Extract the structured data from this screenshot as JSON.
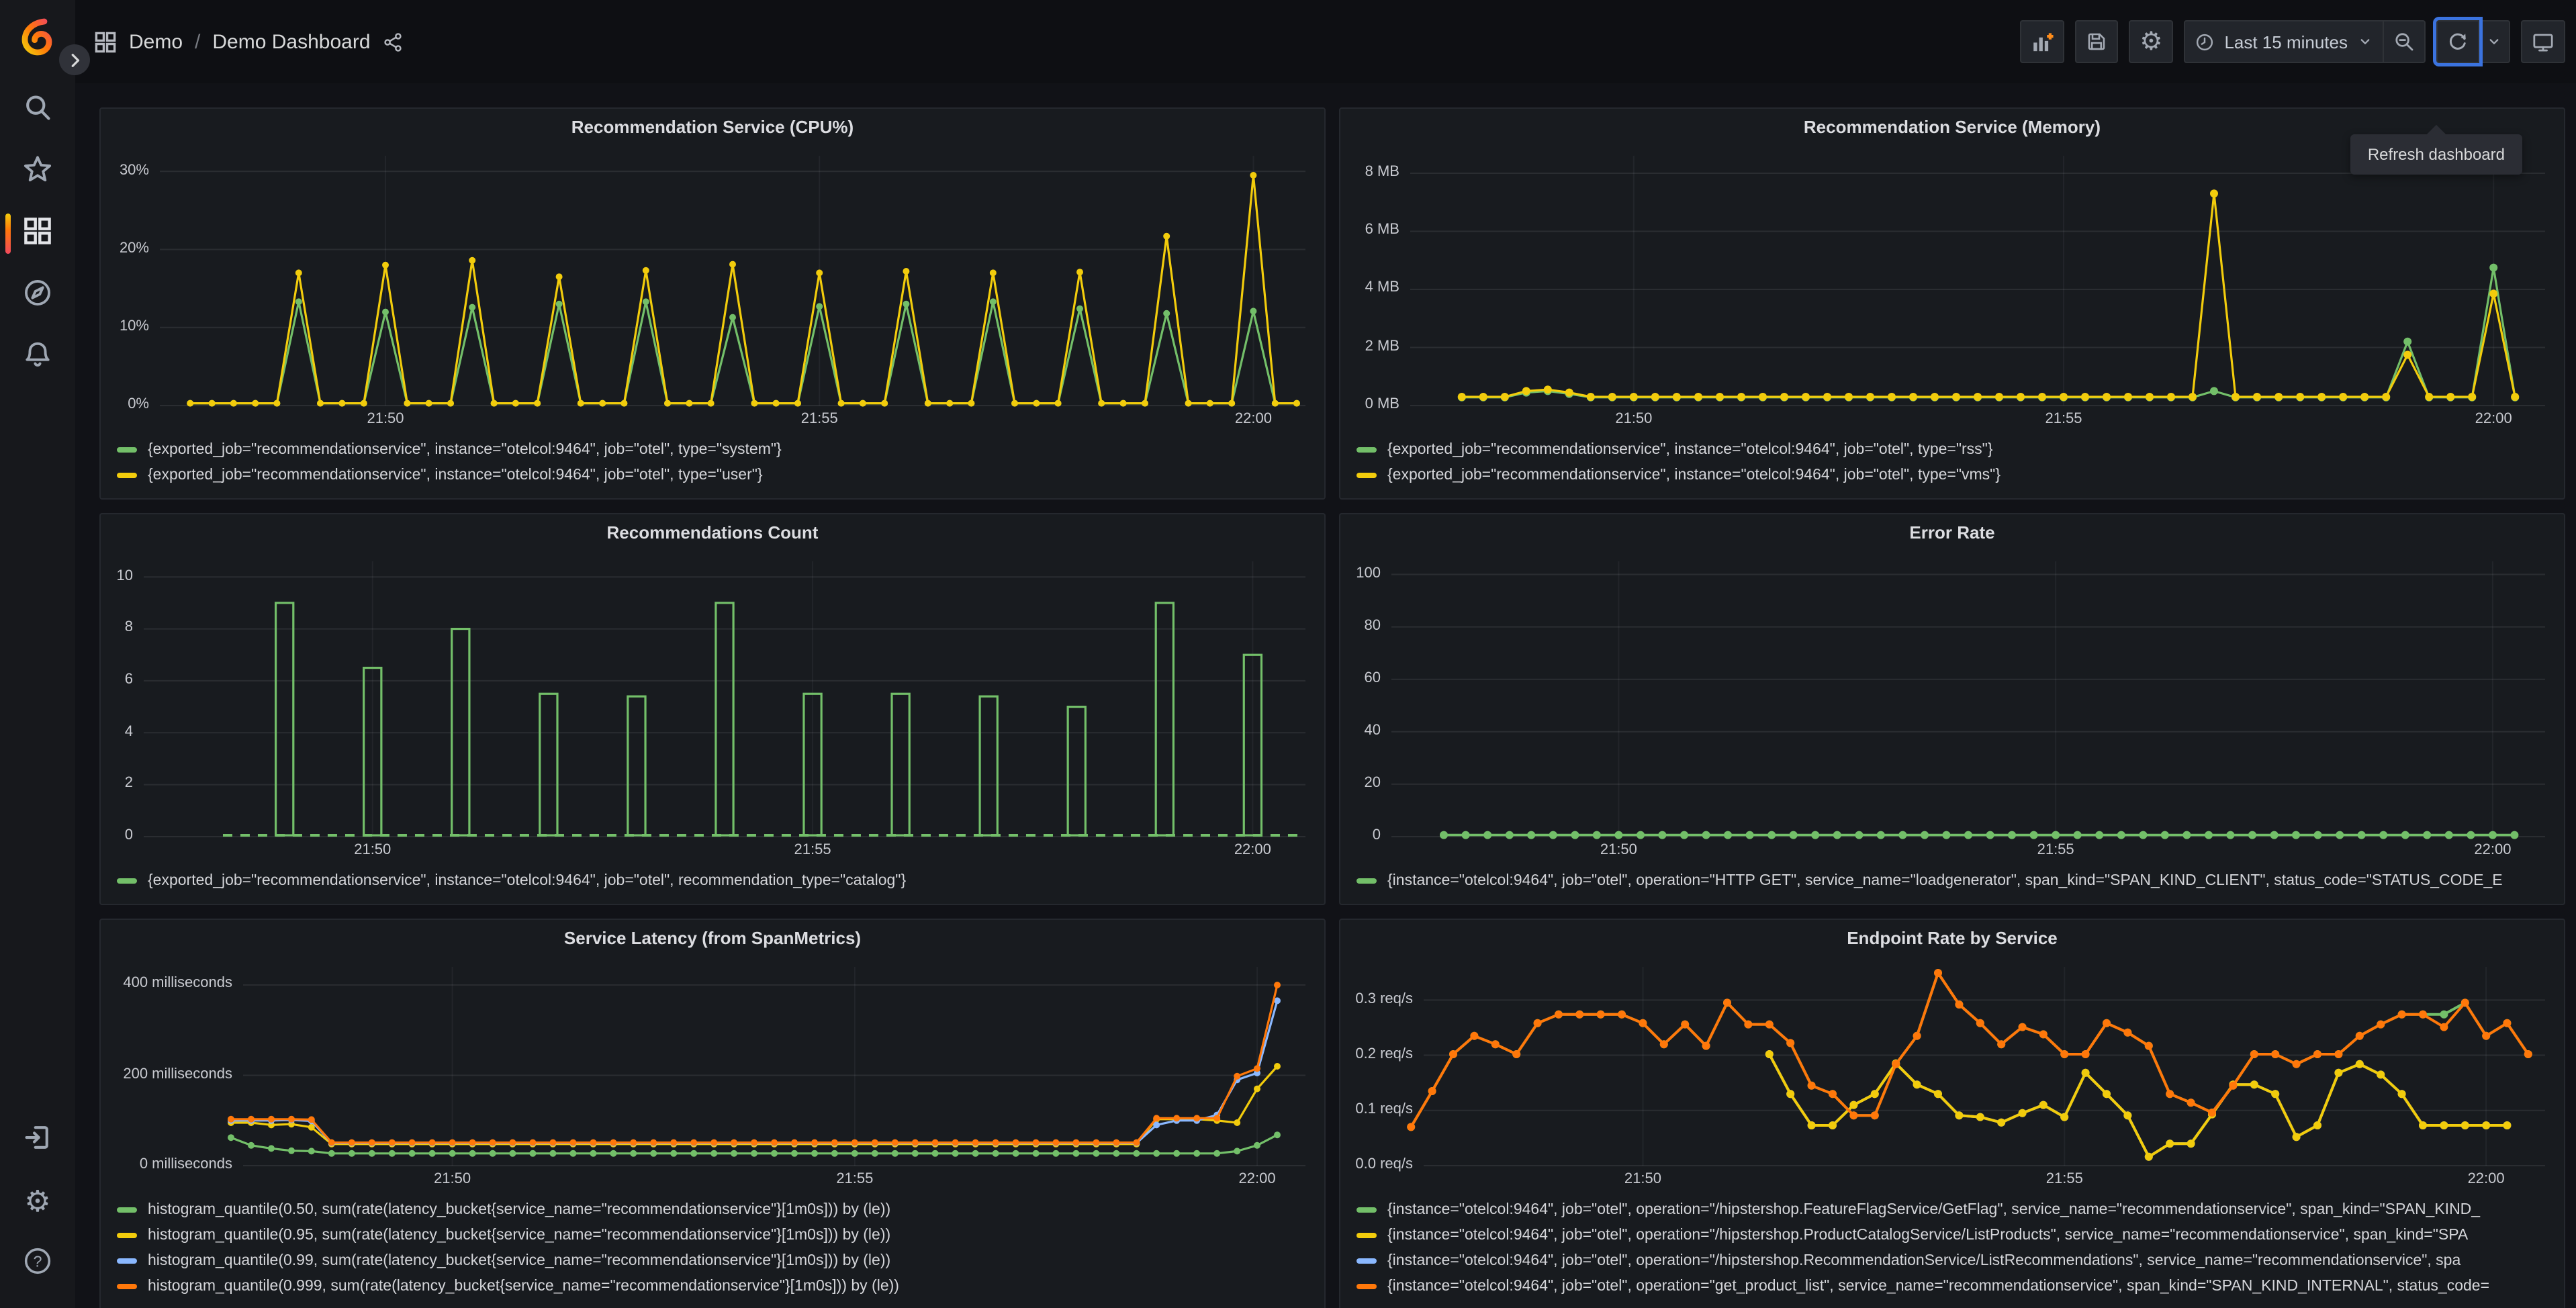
{
  "colors": {
    "green": "#73BF69",
    "yellow": "#F2CC0C",
    "blue": "#8AB8FF",
    "orange": "#FF780A",
    "accent_orange": "#F05A28",
    "focus_blue": "#3B73DF",
    "panel_bg": "#181B1F",
    "page_bg": "#111217"
  },
  "sidebar": {
    "items": [
      {
        "name": "search",
        "icon": "search-icon"
      },
      {
        "name": "starred",
        "icon": "star-icon"
      },
      {
        "name": "dashboards",
        "icon": "apps-icon",
        "active": true
      },
      {
        "name": "explore",
        "icon": "compass-icon"
      },
      {
        "name": "alerting",
        "icon": "bell-icon"
      }
    ],
    "bottom_items": [
      {
        "name": "sign-in",
        "icon": "sign-in-icon"
      },
      {
        "name": "configuration",
        "icon": "gear-icon"
      },
      {
        "name": "help",
        "icon": "help-icon"
      }
    ]
  },
  "topbar": {
    "breadcrumb": {
      "folder": "Demo",
      "separator": "/",
      "dashboard": "Demo Dashboard"
    },
    "time_picker": {
      "label": "Last 15 minutes"
    },
    "tooltip": "Refresh dashboard"
  },
  "panels": [
    {
      "title": "Recommendation Service (CPU%)",
      "legend": [
        {
          "color": "green",
          "label": "{exported_job=\"recommendationservice\", instance=\"otelcol:9464\", job=\"otel\", type=\"system\"}"
        },
        {
          "color": "yellow",
          "label": "{exported_job=\"recommendationservice\", instance=\"otelcol:9464\", job=\"otel\", type=\"user\"}"
        }
      ],
      "chart_data": {
        "type": "line",
        "x_unit": "minutes after 21:45",
        "x_domain": [
          2.4,
          15.6
        ],
        "y_domain": [
          0,
          32
        ],
        "x_ticks": [
          {
            "v": 5,
            "l": "21:50"
          },
          {
            "v": 10,
            "l": "21:55"
          },
          {
            "v": 15,
            "l": "22:00"
          }
        ],
        "y_ticks": [
          {
            "v": 0,
            "l": "0%"
          },
          {
            "v": 10,
            "l": "10%"
          },
          {
            "v": 20,
            "l": "20%"
          },
          {
            "v": 30,
            "l": "30%"
          }
        ],
        "axis_width": 36,
        "series": [
          {
            "name": "system",
            "color": "green",
            "mode": "spikes",
            "start": 2.75,
            "end": 15.5,
            "step": 0.25,
            "baseline": 0.3,
            "r": 2.5,
            "w": 1.6,
            "spikes": {
              "4": 13.3,
              "5": 12,
              "6": 12.6,
              "7": 13,
              "8": 13.3,
              "9": 11.3,
              "10": 12.7,
              "11": 13,
              "12": 13.3,
              "13": 12.4,
              "14": 11.8,
              "15": 12.1
            }
          },
          {
            "name": "user",
            "color": "yellow",
            "mode": "spikes",
            "start": 2.75,
            "end": 15.5,
            "step": 0.25,
            "baseline": 0.3,
            "r": 2.5,
            "w": 1.6,
            "spikes": {
              "4": 17,
              "5": 18,
              "6": 18.6,
              "7": 16.5,
              "8": 17.3,
              "9": 18.1,
              "10": 17,
              "11": 17.2,
              "12": 17,
              "13": 17.1,
              "14": 21.7,
              "15": 29.5
            }
          }
        ]
      }
    },
    {
      "title": "Recommendation Service (Memory)",
      "legend": [
        {
          "color": "green",
          "label": "{exported_job=\"recommendationservice\", instance=\"otelcol:9464\", job=\"otel\", type=\"rss\"}"
        },
        {
          "color": "yellow",
          "label": "{exported_job=\"recommendationservice\", instance=\"otelcol:9464\", job=\"otel\", type=\"vms\"}"
        }
      ],
      "chart_data": {
        "type": "line",
        "x_unit": "minutes after 21:45",
        "x_domain": [
          2.4,
          15.6
        ],
        "y_domain": [
          0,
          8.6
        ],
        "x_ticks": [
          {
            "v": 5,
            "l": "21:50"
          },
          {
            "v": 10,
            "l": "21:55"
          },
          {
            "v": 15,
            "l": "22:00"
          }
        ],
        "y_ticks": [
          {
            "v": 0,
            "l": "0 MB"
          },
          {
            "v": 2,
            "l": "2 MB"
          },
          {
            "v": 4,
            "l": "4 MB"
          },
          {
            "v": 6,
            "l": "6 MB"
          },
          {
            "v": 8,
            "l": "8 MB"
          }
        ],
        "axis_width": 44,
        "series": [
          {
            "name": "rss",
            "color": "green",
            "mode": "spikes",
            "start": 3.0,
            "end": 15.25,
            "step": 0.25,
            "baseline": 0.28,
            "r": 3,
            "w": 1.6,
            "spikes": {
              "3.75": 0.45,
              "4": 0.5,
              "4.25": 0.4,
              "11.75": 0.5,
              "14": 2.2,
              "15": 4.75
            }
          },
          {
            "name": "vms",
            "color": "yellow",
            "mode": "spikes",
            "start": 3.0,
            "end": 15.25,
            "step": 0.25,
            "baseline": 0.3,
            "r": 3,
            "w": 1.6,
            "spikes": {
              "3.75": 0.5,
              "4": 0.55,
              "4.25": 0.45,
              "11.75": 7.3,
              "14": 1.75,
              "15": 3.85
            }
          }
        ]
      }
    },
    {
      "title": "Recommendations Count",
      "legend": [
        {
          "color": "green",
          "label": "{exported_job=\"recommendationservice\", instance=\"otelcol:9464\", job=\"otel\", recommendation_type=\"catalog\"}"
        }
      ],
      "chart_data": {
        "type": "bar",
        "x_unit": "minutes after 21:45",
        "x_domain": [
          2.4,
          15.6
        ],
        "y_domain": [
          0,
          10.6
        ],
        "x_ticks": [
          {
            "v": 5,
            "l": "21:50"
          },
          {
            "v": 10,
            "l": "21:55"
          },
          {
            "v": 15,
            "l": "22:00"
          }
        ],
        "y_ticks": [
          {
            "v": 0,
            "l": "0"
          },
          {
            "v": 2,
            "l": "2"
          },
          {
            "v": 4,
            "l": "4"
          },
          {
            "v": 6,
            "l": "6"
          },
          {
            "v": 8,
            "l": "8"
          },
          {
            "v": 10,
            "l": "10"
          }
        ],
        "axis_width": 24,
        "series": [
          {
            "name": "baseline",
            "color": "green",
            "mode": "dashline",
            "from": 3.3,
            "to": 15.55,
            "y": 0,
            "w": 2
          },
          {
            "name": "catalog",
            "color": "green",
            "mode": "bars",
            "barw": 0.2,
            "w": 1.6,
            "times": [
              4,
              5,
              6,
              7,
              8,
              9,
              10,
              11,
              12,
              13,
              14,
              15
            ],
            "values": [
              9,
              6.5,
              8,
              5.5,
              5.4,
              9,
              5.5,
              5.5,
              5.4,
              5,
              9,
              7
            ]
          }
        ]
      }
    },
    {
      "title": "Error Rate",
      "legend": [
        {
          "color": "green",
          "label": "{instance=\"otelcol:9464\", job=\"otel\", operation=\"HTTP GET\", service_name=\"loadgenerator\", span_kind=\"SPAN_KIND_CLIENT\", status_code=\"STATUS_CODE_E"
        }
      ],
      "chart_data": {
        "type": "line",
        "x_unit": "minutes after 21:45",
        "x_domain": [
          2.4,
          15.6
        ],
        "y_domain": [
          0,
          105
        ],
        "x_ticks": [
          {
            "v": 5,
            "l": "21:50"
          },
          {
            "v": 10,
            "l": "21:55"
          },
          {
            "v": 15,
            "l": "22:00"
          }
        ],
        "y_ticks": [
          {
            "v": 0,
            "l": "0"
          },
          {
            "v": 20,
            "l": "20"
          },
          {
            "v": 40,
            "l": "40"
          },
          {
            "v": 60,
            "l": "60"
          },
          {
            "v": 80,
            "l": "80"
          },
          {
            "v": 100,
            "l": "100"
          }
        ],
        "axis_width": 30,
        "series": [
          {
            "name": "errors",
            "color": "green",
            "mode": "spikes",
            "start": 3.0,
            "end": 15.3,
            "step": 0.25,
            "baseline": 0.6,
            "r": 3,
            "w": 1.8,
            "spikes": {}
          }
        ]
      }
    },
    {
      "title": "Service Latency (from SpanMetrics)",
      "legend": [
        {
          "color": "green",
          "label": "histogram_quantile(0.50, sum(rate(latency_bucket{service_name=\"recommendationservice\"}[1m0s])) by (le))"
        },
        {
          "color": "yellow",
          "label": "histogram_quantile(0.95, sum(rate(latency_bucket{service_name=\"recommendationservice\"}[1m0s])) by (le))"
        },
        {
          "color": "blue",
          "label": "histogram_quantile(0.99, sum(rate(latency_bucket{service_name=\"recommendationservice\"}[1m0s])) by (le))"
        },
        {
          "color": "orange",
          "label": "histogram_quantile(0.999, sum(rate(latency_bucket{service_name=\"recommendationservice\"}[1m0s])) by (le))"
        }
      ],
      "chart_data": {
        "type": "line",
        "x_unit": "minutes after 21:45",
        "y_unit": "milliseconds",
        "x_domain": [
          2.4,
          15.6
        ],
        "y_domain": [
          0,
          440
        ],
        "x_ticks": [
          {
            "v": 5,
            "l": "21:50"
          },
          {
            "v": 10,
            "l": "21:55"
          },
          {
            "v": 15,
            "l": "22:00"
          }
        ],
        "y_ticks": [
          {
            "v": 0,
            "l": "0 milliseconds"
          },
          {
            "v": 200,
            "l": "200 milliseconds"
          },
          {
            "v": 400,
            "l": "400 milliseconds"
          }
        ],
        "axis_width": 98,
        "series": [
          {
            "name": "p50",
            "color": "green",
            "mode": "spikes",
            "start": 2.25,
            "end": 15.25,
            "step": 0.25,
            "baseline": 27,
            "r": 2.5,
            "w": 1.6,
            "spikes": {
              "2.25": 62,
              "2.5": 45,
              "2.75": 38,
              "3": 33,
              "3.25": 32,
              "14.75": 32,
              "15": 45,
              "15.25": 68
            }
          },
          {
            "name": "p95",
            "color": "yellow",
            "mode": "spikes",
            "start": 2.25,
            "end": 15.25,
            "step": 0.25,
            "baseline": 48,
            "r": 2.5,
            "w": 1.6,
            "spikes": {
              "2.25": 95,
              "2.5": 95,
              "2.75": 90,
              "3": 92,
              "3.25": 85,
              "13.75": 103,
              "14": 103,
              "14.25": 103,
              "14.5": 100,
              "14.75": 95,
              "15": 170,
              "15.25": 220
            }
          },
          {
            "name": "p99",
            "color": "blue",
            "mode": "spikes",
            "start": 2.25,
            "end": 15.25,
            "step": 0.25,
            "baseline": 50,
            "r": 2.5,
            "w": 1.6,
            "spikes": {
              "2.25": 100,
              "2.5": 100,
              "2.75": 100,
              "3": 101,
              "3.25": 99,
              "13.75": 90,
              "14": 100,
              "14.25": 100,
              "14.5": 112,
              "14.75": 190,
              "15": 205,
              "15.25": 365
            }
          },
          {
            "name": "p999",
            "color": "orange",
            "mode": "spikes",
            "start": 2.25,
            "end": 15.25,
            "step": 0.25,
            "baseline": 51,
            "r": 2.5,
            "w": 1.6,
            "spikes": {
              "2.25": 103,
              "2.5": 103,
              "2.75": 103,
              "3": 103,
              "3.25": 102,
              "13.75": 105,
              "14": 105,
              "14.25": 105,
              "14.5": 105,
              "14.75": 198,
              "15": 215,
              "15.25": 400
            }
          }
        ]
      }
    },
    {
      "title": "Endpoint Rate by Service",
      "legend": [
        {
          "color": "green",
          "label": "{instance=\"otelcol:9464\", job=\"otel\", operation=\"/hipstershop.FeatureFlagService/GetFlag\", service_name=\"recommendationservice\", span_kind=\"SPAN_KIND_"
        },
        {
          "color": "yellow",
          "label": "{instance=\"otelcol:9464\", job=\"otel\", operation=\"/hipstershop.ProductCatalogService/ListProducts\", service_name=\"recommendationservice\", span_kind=\"SPA"
        },
        {
          "color": "blue",
          "label": "{instance=\"otelcol:9464\", job=\"otel\", operation=\"/hipstershop.RecommendationService/ListRecommendations\", service_name=\"recommendationservice\", spa"
        },
        {
          "color": "orange",
          "label": "{instance=\"otelcol:9464\", job=\"otel\", operation=\"get_product_list\", service_name=\"recommendationservice\", span_kind=\"SPAN_KIND_INTERNAL\", status_code="
        }
      ],
      "chart_data": {
        "type": "line",
        "x_unit": "minutes after 21:45",
        "y_unit": "req/s",
        "x_domain": [
          2.4,
          15.7
        ],
        "y_domain": [
          0,
          0.36
        ],
        "x_ticks": [
          {
            "v": 5,
            "l": "21:50"
          },
          {
            "v": 10,
            "l": "21:55"
          },
          {
            "v": 15,
            "l": "22:00"
          }
        ],
        "y_ticks": [
          {
            "v": 0,
            "l": "0.0 req/s"
          },
          {
            "v": 0.1,
            "l": "0.1 req/s"
          },
          {
            "v": 0.2,
            "l": "0.2 req/s"
          },
          {
            "v": 0.3,
            "l": "0.3 req/s"
          }
        ],
        "axis_width": 54,
        "series": [
          {
            "name": "GetFlag",
            "color": "green",
            "mode": "points",
            "start": 2.25,
            "r": 3,
            "w": 2,
            "values": [
              0.07,
              0.135,
              0.202,
              0.235,
              0.22,
              0.202,
              0.258,
              0.274,
              0.274,
              0.274,
              0.274,
              0.258,
              0.22,
              0.256,
              0.217,
              0.295,
              0.256,
              0.256,
              0.222,
              0.145,
              0.13,
              0.091,
              0.091,
              0.184,
              0.235,
              0.349,
              0.292,
              0.258,
              0.22,
              0.251,
              0.238,
              0.202,
              0.202,
              0.258,
              0.241,
              0.217,
              0.13,
              0.114,
              0.096,
              0.145,
              0.202,
              0.202,
              0.184,
              0.202,
              0.202,
              0.235,
              0.256,
              0.274,
              0.274,
              0.274,
              0.295,
              0.235,
              0.258,
              0.202
            ]
          },
          {
            "name": "ListRecommendations",
            "color": "blue",
            "mode": "points",
            "start": 6.5,
            "r": 3,
            "w": 2,
            "values": [
              0.202,
              0.13,
              0.073,
              0.073,
              0.11,
              0.13,
              0.185,
              0.147,
              0.13,
              0.091,
              0.088,
              0.078,
              0.095,
              0.11,
              0.088,
              0.168,
              0.13,
              0.091,
              0.016,
              0.04,
              0.04,
              0.093,
              0.147,
              0.147,
              0.13,
              0.052,
              0.073,
              0.168,
              0.184,
              0.165,
              0.13,
              0.073,
              0.073,
              0.073,
              0.073,
              0.073
            ]
          },
          {
            "name": "ListProducts",
            "color": "yellow",
            "mode": "points",
            "start": 6.5,
            "r": 3,
            "w": 2,
            "values": [
              0.202,
              0.13,
              0.073,
              0.073,
              0.11,
              0.13,
              0.185,
              0.147,
              0.13,
              0.091,
              0.088,
              0.078,
              0.095,
              0.11,
              0.088,
              0.168,
              0.13,
              0.091,
              0.016,
              0.04,
              0.04,
              0.093,
              0.147,
              0.147,
              0.13,
              0.052,
              0.073,
              0.168,
              0.184,
              0.165,
              0.13,
              0.073,
              0.073,
              0.073,
              0.073,
              0.073
            ]
          },
          {
            "name": "get_product_list",
            "color": "orange",
            "mode": "points",
            "start": 2.25,
            "r": 3,
            "w": 2,
            "values": [
              0.07,
              0.135,
              0.202,
              0.235,
              0.22,
              0.202,
              0.258,
              0.274,
              0.274,
              0.274,
              0.274,
              0.258,
              0.22,
              0.256,
              0.217,
              0.295,
              0.256,
              0.256,
              0.222,
              0.145,
              0.13,
              0.091,
              0.091,
              0.184,
              0.235,
              0.349,
              0.292,
              0.258,
              0.22,
              0.251,
              0.238,
              0.202,
              0.202,
              0.258,
              0.241,
              0.217,
              0.13,
              0.114,
              0.096,
              0.145,
              0.202,
              0.202,
              0.184,
              0.202,
              0.202,
              0.235,
              0.256,
              0.274,
              0.274,
              0.251,
              0.295,
              0.235,
              0.258,
              0.202
            ]
          }
        ]
      }
    }
  ]
}
